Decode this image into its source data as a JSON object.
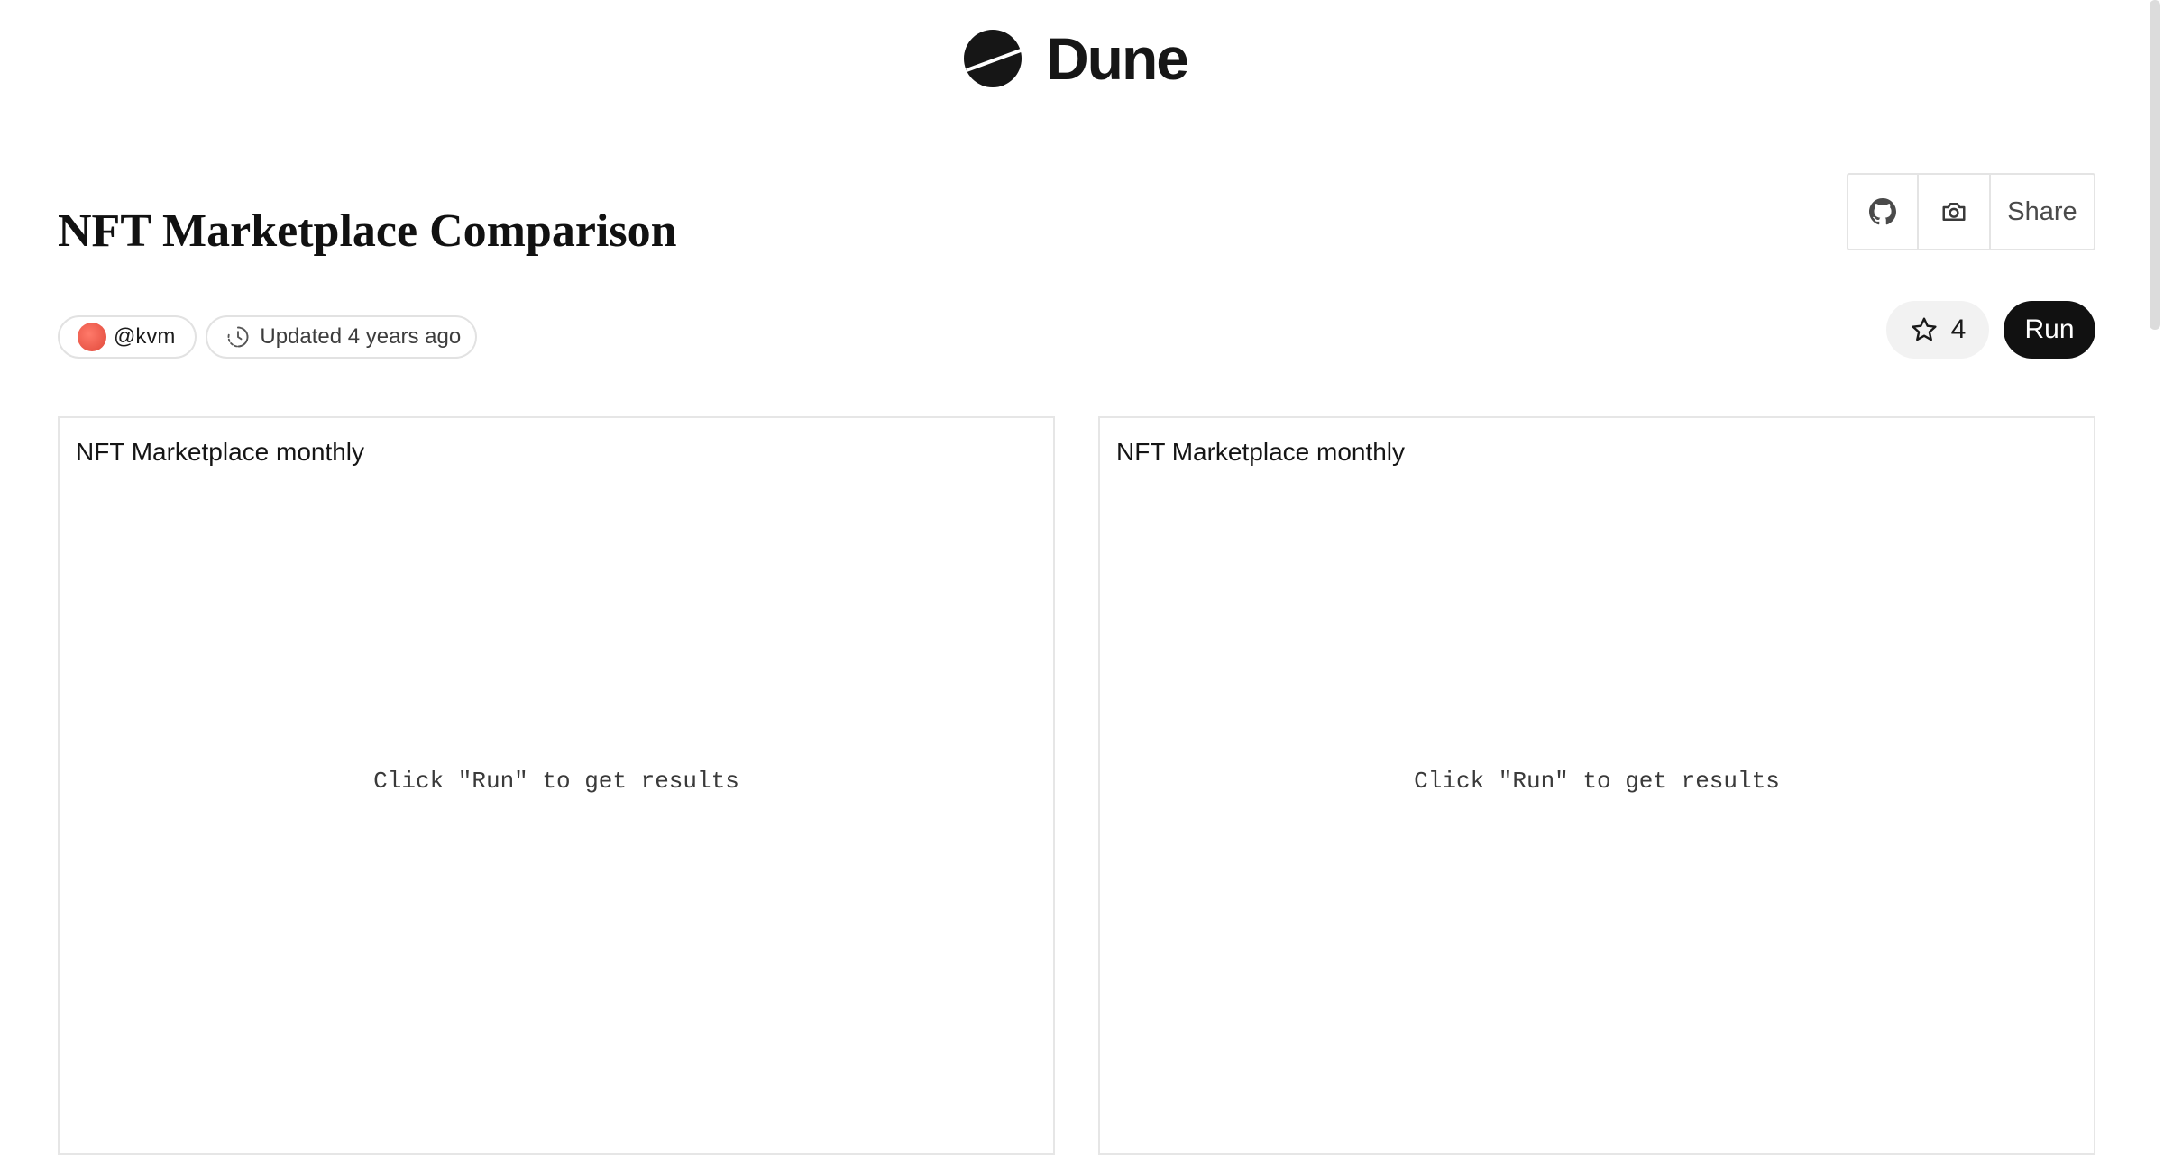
{
  "header": {
    "brand": "Dune",
    "logo_icon": "dune-logo-icon"
  },
  "page": {
    "title": "NFT Marketplace Comparison"
  },
  "actions": {
    "github_icon": "github-icon",
    "camera_icon": "camera-icon",
    "share_label": "Share"
  },
  "meta": {
    "author": "@kvm",
    "updated_label": "Updated",
    "updated_value": "4 years ago"
  },
  "controls": {
    "star_count": "4",
    "run_label": "Run"
  },
  "panels": [
    {
      "title": "NFT Marketplace monthly",
      "empty_message": "Click \"Run\" to get results"
    },
    {
      "title": "NFT Marketplace monthly",
      "empty_message": "Click \"Run\" to get results"
    }
  ]
}
